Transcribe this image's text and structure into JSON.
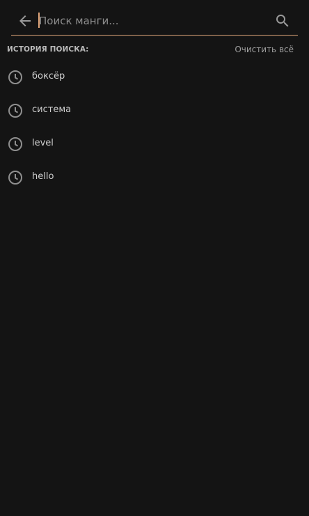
{
  "search": {
    "placeholder": "Поиск манги...",
    "value": "",
    "back_icon": "arrow-left-icon",
    "search_icon": "magnifier-icon"
  },
  "history": {
    "title": "ИСТОРИЯ ПОИСКА:",
    "clear_label": "Очистить всё",
    "items": [
      {
        "label": "боксёр",
        "icon": "clock-icon"
      },
      {
        "label": "система",
        "icon": "clock-icon"
      },
      {
        "label": "level",
        "icon": "clock-icon"
      },
      {
        "label": "hello",
        "icon": "clock-icon"
      }
    ]
  },
  "colors": {
    "background": "#141414",
    "accent": "#e0a57a",
    "text": "#cfcfcf",
    "muted": "#9e9e9e"
  }
}
